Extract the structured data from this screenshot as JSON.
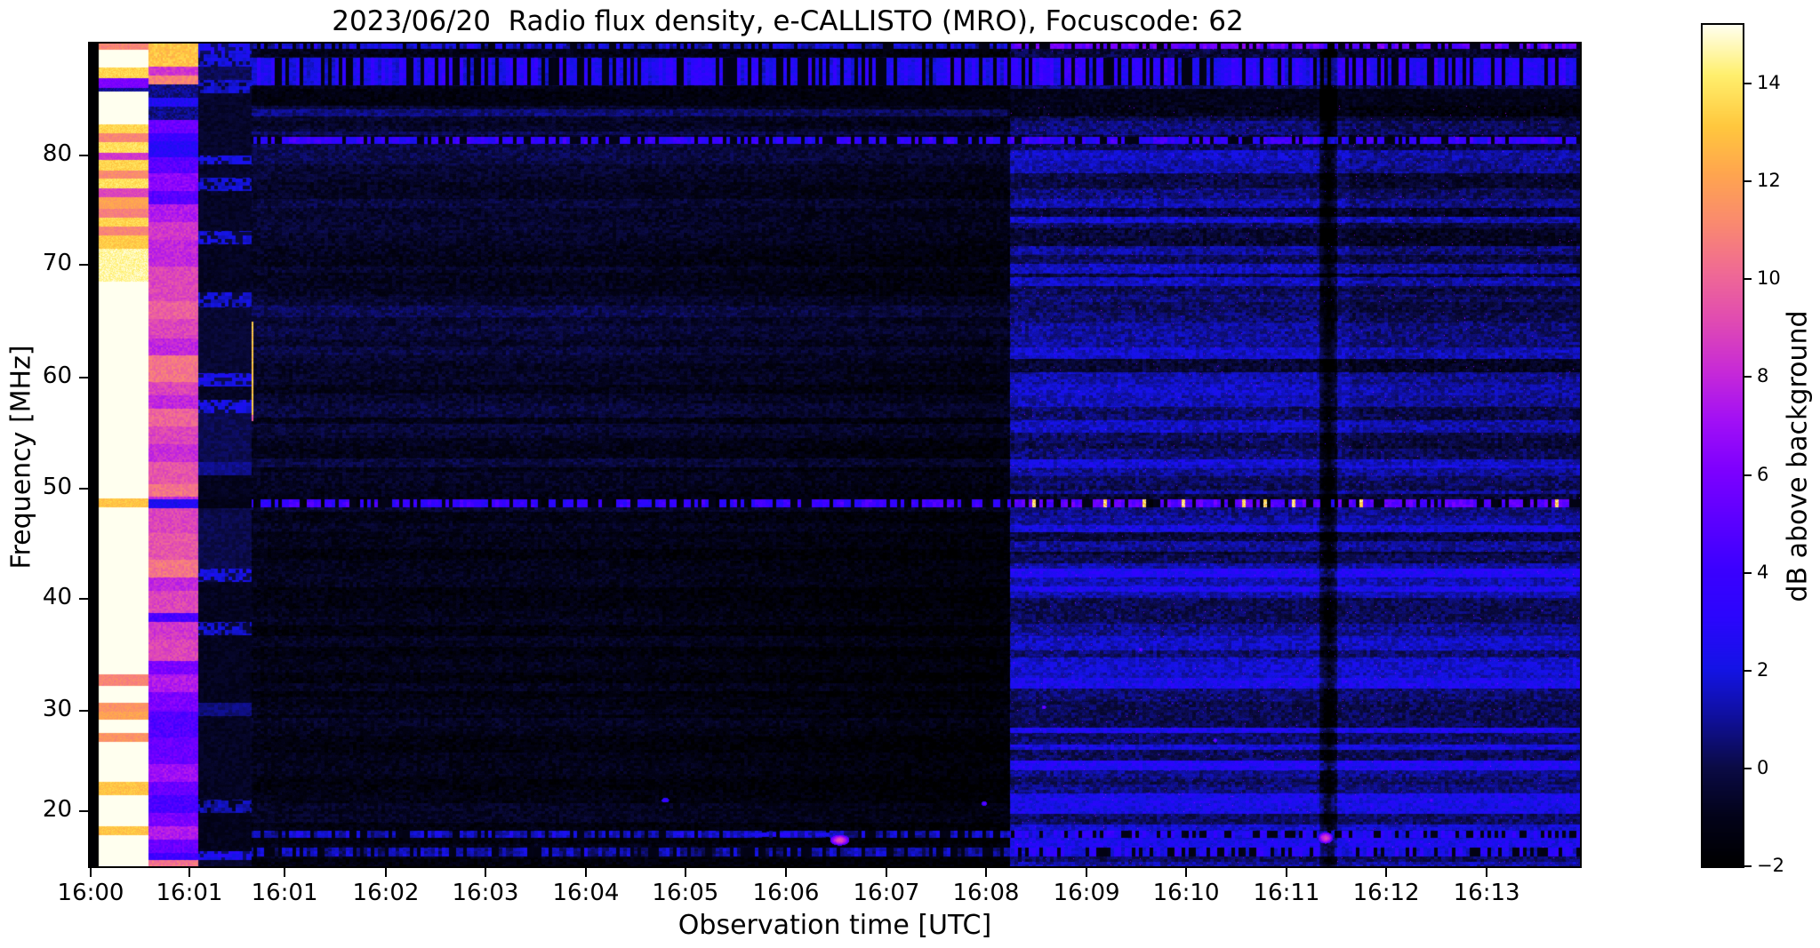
{
  "chart_data": {
    "type": "heatmap",
    "subtype": "radio-spectrogram",
    "title": "2023/06/20  Radio flux density, e-CALLISTO (MRO), Focuscode: 62",
    "xlabel": "Observation time [UTC]",
    "ylabel": "Frequency [MHz]",
    "colorbar_label": "dB above background",
    "value_range": [
      -2,
      15.2
    ],
    "freq_range_mhz": [
      90.1,
      15.8
    ],
    "grid": false,
    "x_ticks": [
      {
        "label": "16:00",
        "frac": 0.0006
      },
      {
        "label": "16:01",
        "frac": 0.0668
      },
      {
        "label": "16:01",
        "frac": 0.1307
      },
      {
        "label": "16:02",
        "frac": 0.1987
      },
      {
        "label": "16:03",
        "frac": 0.2655
      },
      {
        "label": "16:04",
        "frac": 0.3329
      },
      {
        "label": "16:05",
        "frac": 0.3997
      },
      {
        "label": "16:06",
        "frac": 0.4672
      },
      {
        "label": "16:07",
        "frac": 0.5346
      },
      {
        "label": "16:08",
        "frac": 0.6014
      },
      {
        "label": "16:09",
        "frac": 0.6689
      },
      {
        "label": "16:10",
        "frac": 0.7357
      },
      {
        "label": "16:11",
        "frac": 0.8031
      },
      {
        "label": "16:12",
        "frac": 0.87
      },
      {
        "label": "16:13",
        "frac": 0.9374
      }
    ],
    "y_ticks": [
      {
        "label": "80",
        "frac": 0.136
      },
      {
        "label": "70",
        "frac": 0.269
      },
      {
        "label": "60",
        "frac": 0.406
      },
      {
        "label": "50",
        "frac": 0.541
      },
      {
        "label": "40",
        "frac": 0.675
      },
      {
        "label": "30",
        "frac": 0.811
      },
      {
        "label": "20",
        "frac": 0.933
      }
    ],
    "colorbar_ticks": [
      {
        "label": "14",
        "value": 14
      },
      {
        "label": "12",
        "value": 12
      },
      {
        "label": "10",
        "value": 10
      },
      {
        "label": "8",
        "value": 8
      },
      {
        "label": "6",
        "value": 6
      },
      {
        "label": "4",
        "value": 4
      },
      {
        "label": "2",
        "value": 2
      },
      {
        "label": "0",
        "value": 0
      },
      {
        "label": "−2",
        "value": -2
      }
    ],
    "colormap_anchors": [
      [
        0.0,
        "#000000"
      ],
      [
        0.06,
        "#03031a"
      ],
      [
        0.118,
        "#0b0b46"
      ],
      [
        0.18,
        "#1010a0"
      ],
      [
        0.235,
        "#1414e6"
      ],
      [
        0.295,
        "#2b06fd"
      ],
      [
        0.353,
        "#3b00ff"
      ],
      [
        0.47,
        "#7d00ff"
      ],
      [
        0.53,
        "#a210f6"
      ],
      [
        0.588,
        "#c72ad8"
      ],
      [
        0.65,
        "#e14cb2"
      ],
      [
        0.706,
        "#f06a95"
      ],
      [
        0.765,
        "#fa8a70"
      ],
      [
        0.824,
        "#ffa64f"
      ],
      [
        0.88,
        "#ffc83e"
      ],
      [
        0.941,
        "#fff06e"
      ],
      [
        1.0,
        "#ffffef"
      ]
    ],
    "left_black_edge_t": 0.0055,
    "colA": {
      "t0": 0.0055,
      "t1": 0.039,
      "bands": [
        [
          90.1,
          89.5,
          11
        ],
        [
          89.5,
          87.9,
          15.5
        ],
        [
          87.9,
          87.0,
          13.5
        ],
        [
          87.0,
          86.1,
          6
        ],
        [
          86.1,
          85.8,
          1
        ],
        [
          85.8,
          82.8,
          15.5
        ],
        [
          82.8,
          82.0,
          13.5
        ],
        [
          82.0,
          81.2,
          11
        ],
        [
          81.2,
          80.2,
          13.8
        ],
        [
          80.2,
          79.6,
          8.5
        ],
        [
          79.6,
          78.6,
          13.5
        ],
        [
          78.6,
          77.9,
          11.2
        ],
        [
          77.9,
          77.0,
          13.8
        ],
        [
          77.0,
          76.2,
          9
        ],
        [
          76.2,
          75.2,
          12
        ],
        [
          75.2,
          74.4,
          10.8
        ],
        [
          74.4,
          73.6,
          13.5
        ],
        [
          73.6,
          72.8,
          11
        ],
        [
          72.8,
          71.6,
          13.2
        ],
        [
          71.6,
          68.6,
          14.6
        ],
        [
          68.6,
          49.0,
          16
        ],
        [
          49.0,
          48.2,
          13
        ],
        [
          48.2,
          33.1,
          16
        ],
        [
          33.1,
          32.1,
          11
        ],
        [
          32.1,
          30.6,
          16
        ],
        [
          30.6,
          29.8,
          11.5
        ],
        [
          29.8,
          29.0,
          12
        ],
        [
          29.0,
          27.8,
          16
        ],
        [
          27.8,
          27.0,
          11.5
        ],
        [
          27.0,
          23.4,
          16
        ],
        [
          23.4,
          22.2,
          13
        ],
        [
          22.2,
          19.4,
          16
        ],
        [
          19.4,
          18.6,
          13
        ],
        [
          18.6,
          15.8,
          16
        ]
      ]
    },
    "colB": {
      "t0": 0.039,
      "t1": 0.0727,
      "bands": [
        [
          90.1,
          88.0,
          13
        ],
        [
          88.0,
          87.2,
          8.5
        ],
        [
          87.2,
          86.4,
          11
        ],
        [
          86.4,
          85.2,
          0.8
        ],
        [
          85.2,
          84.4,
          2.6
        ],
        [
          84.4,
          83.2,
          0.8
        ],
        [
          83.2,
          82.0,
          5.5
        ],
        [
          82.0,
          81.3,
          4
        ],
        [
          81.3,
          79.8,
          3
        ],
        [
          79.8,
          78.4,
          5
        ],
        [
          78.4,
          76.8,
          6.5
        ],
        [
          76.8,
          75.6,
          5
        ],
        [
          75.6,
          74.0,
          7.5
        ],
        [
          74.0,
          72.4,
          8.5
        ],
        [
          72.4,
          70.0,
          8
        ],
        [
          70.0,
          66.8,
          9
        ],
        [
          66.8,
          65.2,
          9.8
        ],
        [
          65.2,
          63.5,
          9
        ],
        [
          63.5,
          61.9,
          8
        ],
        [
          61.9,
          59.5,
          10.5
        ],
        [
          59.5,
          58.3,
          9
        ],
        [
          58.3,
          57.1,
          8
        ],
        [
          57.1,
          55.5,
          10
        ],
        [
          55.5,
          53.9,
          9
        ],
        [
          53.9,
          52.3,
          8.2
        ],
        [
          52.3,
          50.3,
          9.5
        ],
        [
          50.3,
          49.2,
          10.5
        ],
        [
          49.2,
          48.9,
          8
        ],
        [
          48.9,
          48.1,
          2.5
        ],
        [
          48.1,
          45.9,
          9
        ],
        [
          45.9,
          43.5,
          9.5
        ],
        [
          43.5,
          41.9,
          10.5
        ],
        [
          41.9,
          40.7,
          8
        ],
        [
          40.7,
          38.7,
          9
        ],
        [
          38.7,
          37.9,
          4.5
        ],
        [
          37.9,
          36.3,
          8.5
        ],
        [
          36.3,
          34.3,
          9
        ],
        [
          34.3,
          33.1,
          6
        ],
        [
          33.1,
          31.5,
          7.5
        ],
        [
          31.5,
          29.8,
          6
        ],
        [
          29.8,
          27.4,
          4.8
        ],
        [
          27.4,
          25.0,
          5.5
        ],
        [
          25.0,
          23.4,
          7
        ],
        [
          23.4,
          22.2,
          5.5
        ],
        [
          22.2,
          20.6,
          4.6
        ],
        [
          20.6,
          19.4,
          6
        ],
        [
          19.4,
          18.2,
          7.5
        ],
        [
          18.2,
          17.0,
          5.5
        ],
        [
          17.0,
          16.4,
          4.2
        ],
        [
          16.4,
          15.8,
          10.5
        ]
      ]
    },
    "colC": {
      "t0": 0.0727,
      "t1": 0.108,
      "bands": [
        [
          90.1,
          89.2,
          2.2
        ],
        [
          89.2,
          88.0,
          1.8
        ],
        [
          88.0,
          86.8,
          0.2
        ],
        [
          86.8,
          85.6,
          1.5
        ],
        [
          85.6,
          80.0,
          -0.6
        ],
        [
          80.0,
          79.2,
          1.8
        ],
        [
          79.2,
          78.0,
          -0.6
        ],
        [
          78.0,
          76.8,
          1.5
        ],
        [
          76.8,
          73.2,
          -0.7
        ],
        [
          73.2,
          72.0,
          1.6
        ],
        [
          72.0,
          67.6,
          -0.8
        ],
        [
          67.6,
          66.3,
          1.5
        ],
        [
          66.3,
          60.3,
          -0.4
        ],
        [
          60.3,
          59.1,
          2.0
        ],
        [
          59.1,
          57.9,
          -0.7
        ],
        [
          57.9,
          56.7,
          1.8
        ],
        [
          56.7,
          52.3,
          0.1
        ],
        [
          52.3,
          51.1,
          0.8
        ],
        [
          51.1,
          48.9,
          -0.9
        ],
        [
          48.9,
          48.1,
          -1.2
        ],
        [
          48.1,
          42.7,
          0.0
        ],
        [
          42.7,
          41.5,
          1.8
        ],
        [
          41.5,
          37.9,
          -0.9
        ],
        [
          37.9,
          36.7,
          1.5
        ],
        [
          36.7,
          30.6,
          -0.9
        ],
        [
          30.6,
          29.4,
          0.6
        ],
        [
          29.4,
          21.8,
          -0.8
        ],
        [
          21.8,
          20.6,
          1.0
        ],
        [
          20.6,
          17.2,
          -1.0
        ],
        [
          17.2,
          16.4,
          2.2
        ],
        [
          16.4,
          15.8,
          -0.5
        ]
      ]
    },
    "epoch_boundary_t": 0.617,
    "dark_epoch": {
      "base": -1.25,
      "amp_top": 2.3,
      "amp_high": 1.45,
      "amp_mid": 1.0,
      "amp_low": 0.8,
      "end_fade": 1.9,
      "early_boost": 1.2
    },
    "bright_epoch": {
      "base": -0.5,
      "amp": 2.6,
      "low_freq_boost": 0.55,
      "top_dim_band": [
        86,
        83.5
      ],
      "top_dim": -1.0,
      "late_dim": -0.45,
      "late_dim_t": 0.845
    },
    "shared_rows": [
      {
        "f": [
          90.1,
          89.6
        ],
        "dark": 1.2,
        "bright": 4.8,
        "dash": true
      },
      {
        "f": [
          88.8,
          86.3
        ],
        "dark": 2.2,
        "bright": 2.6,
        "dash": true
      },
      {
        "f": [
          86.0,
          84.5
        ],
        "dark": -1.4,
        "bright": -1.1,
        "dash": false
      },
      {
        "f": [
          81.7,
          81.0
        ],
        "dark": 3.0,
        "bright": 3.2,
        "dash": true
      },
      {
        "f": [
          48.9,
          48.2
        ],
        "dark": 3.2,
        "bright": 4.6,
        "dash": true,
        "hot": true
      },
      {
        "f": [
          19.0,
          18.4
        ],
        "dark": 1.0,
        "bright": 2.4,
        "dash": true
      },
      {
        "f": [
          17.5,
          16.7
        ],
        "dark": 0.6,
        "bright": 2.2,
        "dash": true
      }
    ],
    "events": [
      {
        "t": 0.47,
        "f": 18.7,
        "w": 0.07,
        "h": 0.007,
        "db": 3.2,
        "dash": true
      },
      {
        "t": 0.503,
        "f": 18.2,
        "w": 0.013,
        "h": 0.013,
        "db": 9.2,
        "dash": false
      },
      {
        "t": 0.829,
        "f": 18.4,
        "w": 0.01,
        "h": 0.014,
        "db": 9.0,
        "dash": false
      },
      {
        "t": 0.386,
        "f": 21.8,
        "w": 0.005,
        "h": 0.006,
        "db": 4.5,
        "dash": false
      },
      {
        "t": 0.6,
        "f": 21.5,
        "w": 0.004,
        "h": 0.006,
        "db": 5.5,
        "dash": false
      },
      {
        "t": 0.64,
        "f": 30.2,
        "w": 0.003,
        "h": 0.005,
        "db": 6.5,
        "dash": false
      },
      {
        "t": 0.705,
        "f": 35.4,
        "w": 0.003,
        "h": 0.005,
        "db": 6.0,
        "dash": false
      },
      {
        "t": 0.755,
        "f": 27.2,
        "w": 0.003,
        "h": 0.005,
        "db": 6.0,
        "dash": false
      },
      {
        "t": 0.9,
        "f": 21.8,
        "w": 0.003,
        "h": 0.005,
        "db": 5.5,
        "dash": false
      }
    ],
    "yellow_line": {
      "t": 0.1086,
      "f_hi": 65.0,
      "f_lo": 56.0,
      "db": 12.5,
      "tip_db": 9
    },
    "dark_lane": {
      "t": 0.831,
      "half_width": 0.006,
      "delta": -2.8
    }
  }
}
